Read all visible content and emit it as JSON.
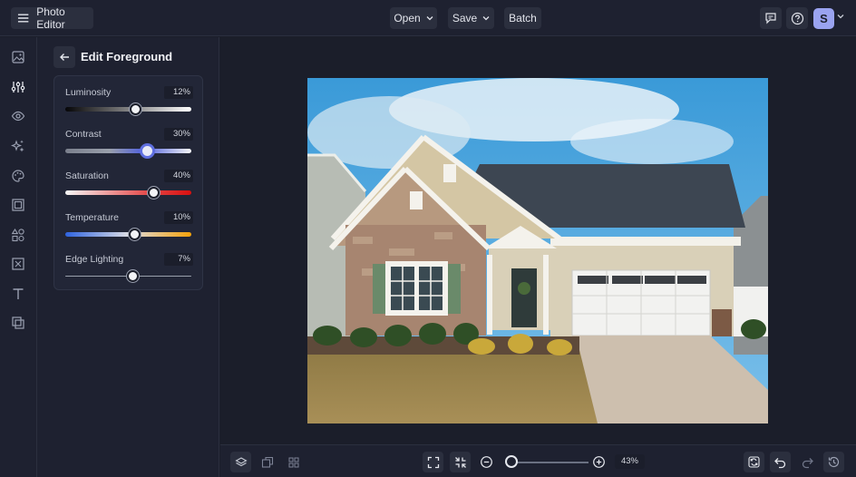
{
  "app": {
    "title": "Photo Editor"
  },
  "topbar": {
    "open_label": "Open",
    "save_label": "Save",
    "batch_label": "Batch",
    "avatar_initial": "S"
  },
  "rail": {
    "items": [
      "image-icon",
      "sliders-icon",
      "eye-icon",
      "sparkle-icon",
      "palette-icon",
      "frame-icon",
      "shapes-icon",
      "texture-icon",
      "text-icon",
      "overlay-icon"
    ],
    "active": "sliders-icon"
  },
  "panel": {
    "title": "Edit Foreground",
    "controls": [
      {
        "label": "Luminosity",
        "value_text": "12%",
        "value": 12
      },
      {
        "label": "Contrast",
        "value_text": "30%",
        "value": 30
      },
      {
        "label": "Saturation",
        "value_text": "40%",
        "value": 40
      },
      {
        "label": "Temperature",
        "value_text": "10%",
        "value": 10
      },
      {
        "label": "Edge Lighting",
        "value_text": "7%",
        "value": 7
      }
    ]
  },
  "bottombar": {
    "zoom_text": "43%",
    "zoom": 43
  },
  "colors": {
    "accent": "#5f6fe0",
    "avatar": "#9aa3f0",
    "background": "#1b1e2a"
  }
}
